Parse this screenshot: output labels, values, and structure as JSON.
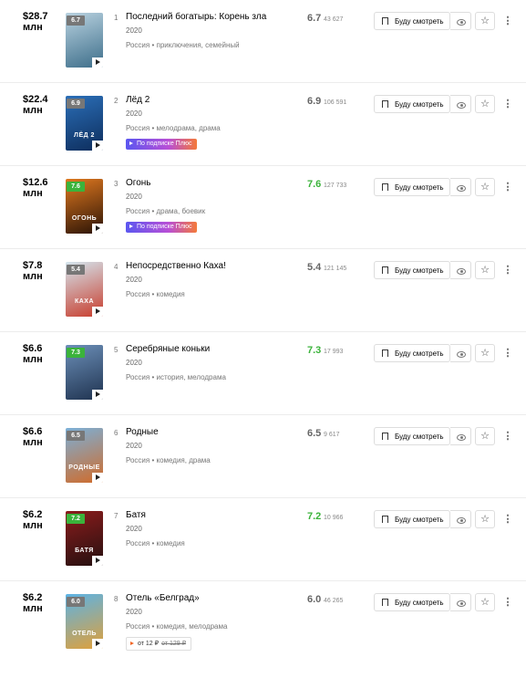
{
  "labels": {
    "watch": "Буду смотреть",
    "subscription": "По подписке Плюс",
    "mln": "млн"
  },
  "icons": {
    "watch": "bookmark-icon",
    "seen": "eye-icon",
    "favorite": "star-icon",
    "more": "more-vertical-icon",
    "play": "play-icon"
  },
  "colors": {
    "rating_good": "#3bb33b",
    "rating_neutral": "#777777",
    "subscription_gradient": [
      "#5b57f0",
      "#b84fd6",
      "#f47a3a"
    ],
    "price_accent": "#f26522"
  },
  "movies": [
    {
      "box": "$28.7",
      "pos": "1",
      "title": "Последний богатырь: Корень зла",
      "year": "2020",
      "meta": "Россия • приключения, семейный",
      "rating": "6.7",
      "votes": "43 627",
      "rating_good": false,
      "poster_colors": [
        "#b9d2e0",
        "#3d6e8a"
      ],
      "poster_word": ""
    },
    {
      "box": "$22.4",
      "pos": "2",
      "title": "Лёд 2",
      "year": "2020",
      "meta": "Россия • мелодрама, драма",
      "rating": "6.9",
      "votes": "106 591",
      "rating_good": false,
      "poster_colors": [
        "#2b6fb8",
        "#0d2d5c"
      ],
      "poster_word": "ЛЁД 2",
      "subscription": true
    },
    {
      "box": "$12.6",
      "pos": "3",
      "title": "Огонь",
      "year": "2020",
      "meta": "Россия • драма, боевик",
      "rating": "7.6",
      "votes": "127 733",
      "rating_good": true,
      "poster_colors": [
        "#e0781f",
        "#2a1306"
      ],
      "poster_word": "ОГОНЬ",
      "subscription": true
    },
    {
      "box": "$7.8",
      "pos": "4",
      "title": "Непосредственно Каха!",
      "year": "2020",
      "meta": "Россия • комедия",
      "rating": "5.4",
      "votes": "121 145",
      "rating_good": false,
      "poster_colors": [
        "#d4e6ef",
        "#c83c2c"
      ],
      "poster_word": "КАХА"
    },
    {
      "box": "$6.6",
      "pos": "5",
      "title": "Серебряные коньки",
      "year": "2020",
      "meta": "Россия • история, мелодрама",
      "rating": "7.3",
      "votes": "17 993",
      "rating_good": true,
      "poster_colors": [
        "#6c8fb8",
        "#1f3350"
      ],
      "poster_word": ""
    },
    {
      "box": "$6.6",
      "pos": "6",
      "title": "Родные",
      "year": "2020",
      "meta": "Россия • комедия, драма",
      "rating": "6.5",
      "votes": "9 617",
      "rating_good": false,
      "poster_colors": [
        "#7bb0d8",
        "#d06b2a"
      ],
      "poster_word": "РОДНЫЕ"
    },
    {
      "box": "$6.2",
      "pos": "7",
      "title": "Батя",
      "year": "2020",
      "meta": "Россия • комедия",
      "rating": "7.2",
      "votes": "10 966",
      "rating_good": true,
      "poster_colors": [
        "#8b1c1c",
        "#241010"
      ],
      "poster_word": "БАТЯ"
    },
    {
      "box": "$6.2",
      "pos": "8",
      "title": "Отель «Белград»",
      "year": "2020",
      "meta": "Россия • комедия, мелодрама",
      "rating": "6.0",
      "votes": "46 265",
      "rating_good": false,
      "poster_colors": [
        "#5bb3e6",
        "#e0a03a"
      ],
      "poster_word": "ОТЕЛЬ",
      "price": "от 12 ₽",
      "price_old": "от 129 ₽"
    }
  ]
}
